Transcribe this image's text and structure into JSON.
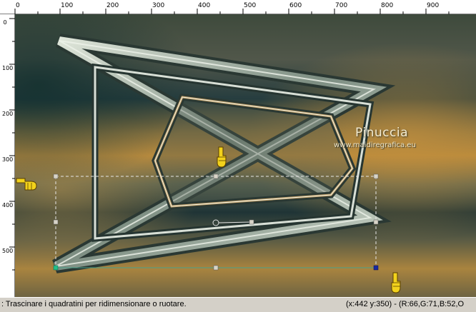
{
  "ruler": {
    "top_labels": [
      "0",
      "100",
      "200",
      "300",
      "400",
      "500",
      "600",
      "700",
      "800",
      "900"
    ],
    "left_labels": [
      "0",
      "100",
      "200",
      "300",
      "400",
      "500"
    ]
  },
  "watermark": {
    "name": "Pinuccia",
    "url": "www.maidiregrafica.eu"
  },
  "status": {
    "message": ": Trascinare i quadratini per ridimensionare o ruotare.",
    "coords": "(x:442 y:350) - (R:66,G:71,B:52,O"
  },
  "colors": {
    "bg_dark": "#283a38",
    "bg_gold": "#b88a3c",
    "frame_highlight": "#e8eee4",
    "selection": "#e6e6e6",
    "pointer": "#f2d21c"
  },
  "icons": {
    "pointer": "hand-pointer-icon",
    "pick": "pick-node-icon"
  }
}
